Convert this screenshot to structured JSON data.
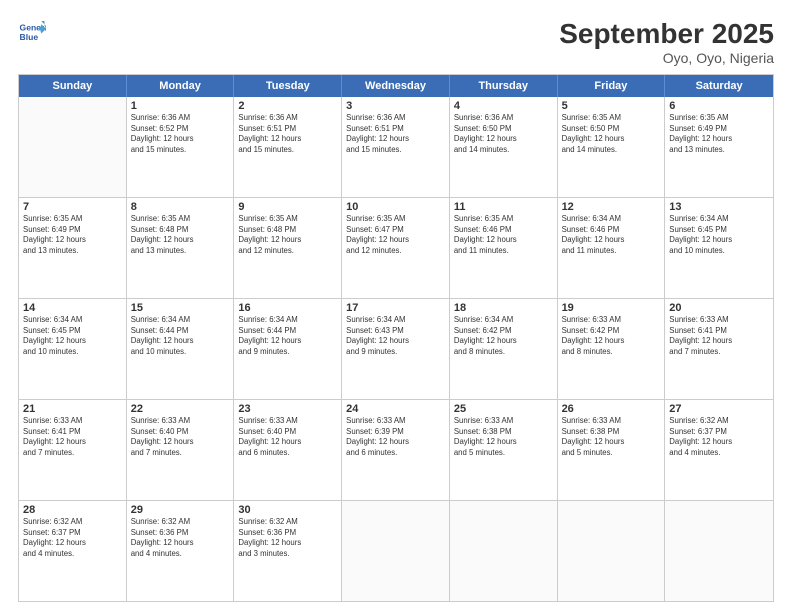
{
  "header": {
    "logo_line1": "General",
    "logo_line2": "Blue",
    "month": "September 2025",
    "location": "Oyo, Oyo, Nigeria"
  },
  "weekdays": [
    "Sunday",
    "Monday",
    "Tuesday",
    "Wednesday",
    "Thursday",
    "Friday",
    "Saturday"
  ],
  "rows": [
    [
      {
        "day": "",
        "info": ""
      },
      {
        "day": "1",
        "info": "Sunrise: 6:36 AM\nSunset: 6:52 PM\nDaylight: 12 hours\nand 15 minutes."
      },
      {
        "day": "2",
        "info": "Sunrise: 6:36 AM\nSunset: 6:51 PM\nDaylight: 12 hours\nand 15 minutes."
      },
      {
        "day": "3",
        "info": "Sunrise: 6:36 AM\nSunset: 6:51 PM\nDaylight: 12 hours\nand 15 minutes."
      },
      {
        "day": "4",
        "info": "Sunrise: 6:36 AM\nSunset: 6:50 PM\nDaylight: 12 hours\nand 14 minutes."
      },
      {
        "day": "5",
        "info": "Sunrise: 6:35 AM\nSunset: 6:50 PM\nDaylight: 12 hours\nand 14 minutes."
      },
      {
        "day": "6",
        "info": "Sunrise: 6:35 AM\nSunset: 6:49 PM\nDaylight: 12 hours\nand 13 minutes."
      }
    ],
    [
      {
        "day": "7",
        "info": "Sunrise: 6:35 AM\nSunset: 6:49 PM\nDaylight: 12 hours\nand 13 minutes."
      },
      {
        "day": "8",
        "info": "Sunrise: 6:35 AM\nSunset: 6:48 PM\nDaylight: 12 hours\nand 13 minutes."
      },
      {
        "day": "9",
        "info": "Sunrise: 6:35 AM\nSunset: 6:48 PM\nDaylight: 12 hours\nand 12 minutes."
      },
      {
        "day": "10",
        "info": "Sunrise: 6:35 AM\nSunset: 6:47 PM\nDaylight: 12 hours\nand 12 minutes."
      },
      {
        "day": "11",
        "info": "Sunrise: 6:35 AM\nSunset: 6:46 PM\nDaylight: 12 hours\nand 11 minutes."
      },
      {
        "day": "12",
        "info": "Sunrise: 6:34 AM\nSunset: 6:46 PM\nDaylight: 12 hours\nand 11 minutes."
      },
      {
        "day": "13",
        "info": "Sunrise: 6:34 AM\nSunset: 6:45 PM\nDaylight: 12 hours\nand 10 minutes."
      }
    ],
    [
      {
        "day": "14",
        "info": "Sunrise: 6:34 AM\nSunset: 6:45 PM\nDaylight: 12 hours\nand 10 minutes."
      },
      {
        "day": "15",
        "info": "Sunrise: 6:34 AM\nSunset: 6:44 PM\nDaylight: 12 hours\nand 10 minutes."
      },
      {
        "day": "16",
        "info": "Sunrise: 6:34 AM\nSunset: 6:44 PM\nDaylight: 12 hours\nand 9 minutes."
      },
      {
        "day": "17",
        "info": "Sunrise: 6:34 AM\nSunset: 6:43 PM\nDaylight: 12 hours\nand 9 minutes."
      },
      {
        "day": "18",
        "info": "Sunrise: 6:34 AM\nSunset: 6:42 PM\nDaylight: 12 hours\nand 8 minutes."
      },
      {
        "day": "19",
        "info": "Sunrise: 6:33 AM\nSunset: 6:42 PM\nDaylight: 12 hours\nand 8 minutes."
      },
      {
        "day": "20",
        "info": "Sunrise: 6:33 AM\nSunset: 6:41 PM\nDaylight: 12 hours\nand 7 minutes."
      }
    ],
    [
      {
        "day": "21",
        "info": "Sunrise: 6:33 AM\nSunset: 6:41 PM\nDaylight: 12 hours\nand 7 minutes."
      },
      {
        "day": "22",
        "info": "Sunrise: 6:33 AM\nSunset: 6:40 PM\nDaylight: 12 hours\nand 7 minutes."
      },
      {
        "day": "23",
        "info": "Sunrise: 6:33 AM\nSunset: 6:40 PM\nDaylight: 12 hours\nand 6 minutes."
      },
      {
        "day": "24",
        "info": "Sunrise: 6:33 AM\nSunset: 6:39 PM\nDaylight: 12 hours\nand 6 minutes."
      },
      {
        "day": "25",
        "info": "Sunrise: 6:33 AM\nSunset: 6:38 PM\nDaylight: 12 hours\nand 5 minutes."
      },
      {
        "day": "26",
        "info": "Sunrise: 6:33 AM\nSunset: 6:38 PM\nDaylight: 12 hours\nand 5 minutes."
      },
      {
        "day": "27",
        "info": "Sunrise: 6:32 AM\nSunset: 6:37 PM\nDaylight: 12 hours\nand 4 minutes."
      }
    ],
    [
      {
        "day": "28",
        "info": "Sunrise: 6:32 AM\nSunset: 6:37 PM\nDaylight: 12 hours\nand 4 minutes."
      },
      {
        "day": "29",
        "info": "Sunrise: 6:32 AM\nSunset: 6:36 PM\nDaylight: 12 hours\nand 4 minutes."
      },
      {
        "day": "30",
        "info": "Sunrise: 6:32 AM\nSunset: 6:36 PM\nDaylight: 12 hours\nand 3 minutes."
      },
      {
        "day": "",
        "info": ""
      },
      {
        "day": "",
        "info": ""
      },
      {
        "day": "",
        "info": ""
      },
      {
        "day": "",
        "info": ""
      }
    ]
  ]
}
